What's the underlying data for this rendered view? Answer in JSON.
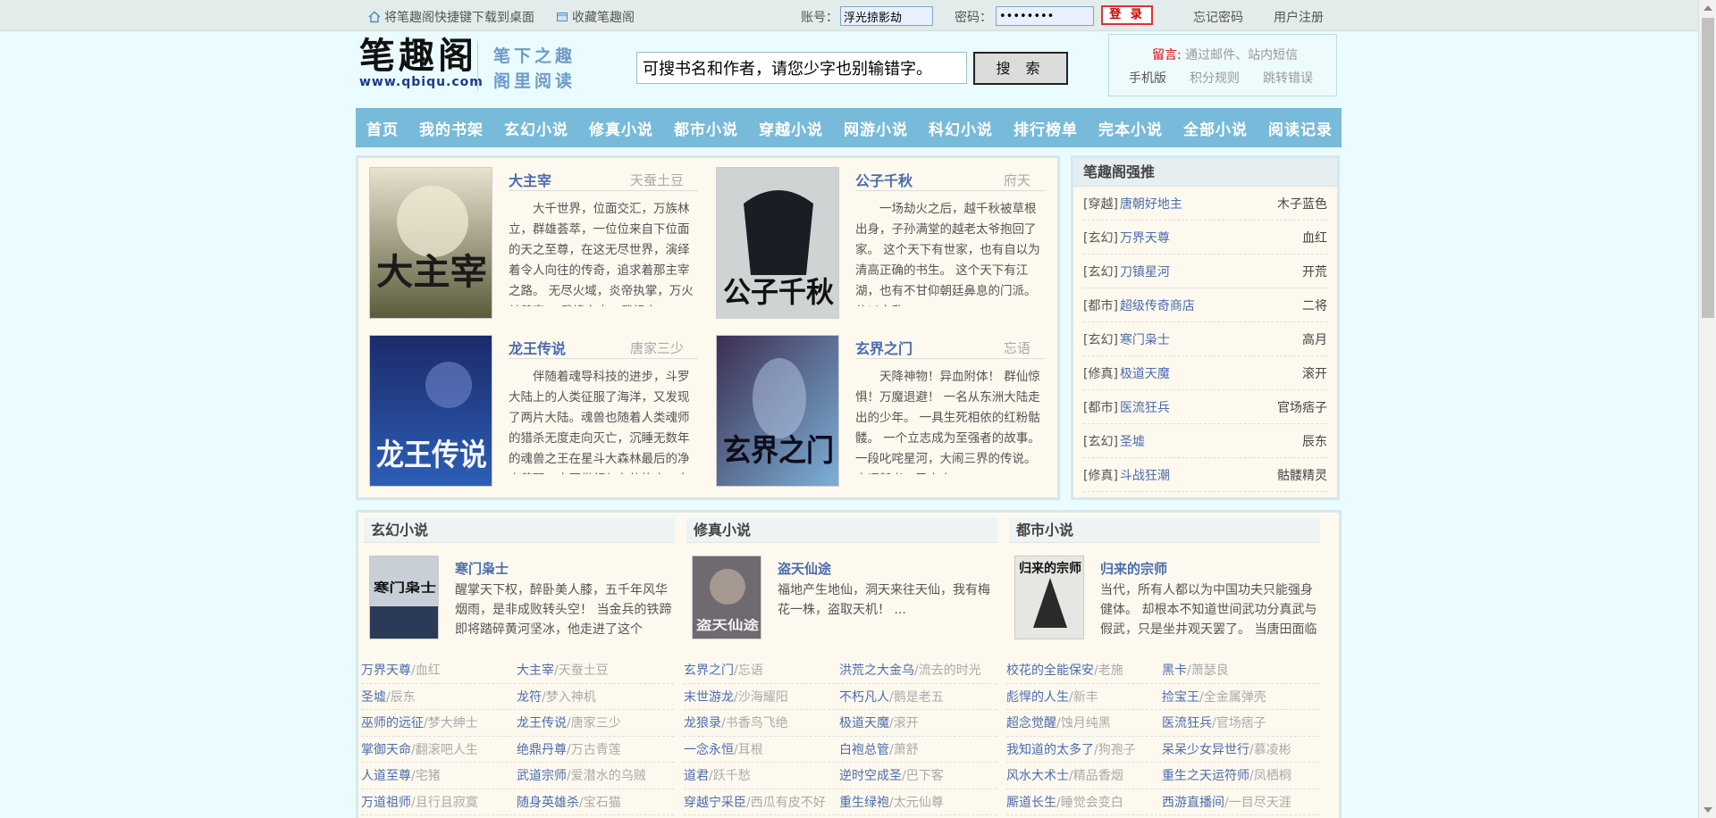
{
  "topbar": {
    "shortcut_label": "将笔趣阁快捷键下载到桌面",
    "favorite_label": "收藏笔趣阁",
    "account_label": "账号：",
    "account_value": "浮光掠影劫",
    "password_label": "密码：",
    "password_value": "••••••••",
    "login_label": "登 录",
    "forgot_label": "忘记密码",
    "register_label": "用户注册"
  },
  "header": {
    "logo_cn": "笔趣阁",
    "logo_url": "www.qbiqu.com",
    "slogan_1": "笔下之趣",
    "slogan_2": "阁里阅读",
    "search_value": "可搜书名和作者，请您少字也别输错字。",
    "search_button": "搜 索",
    "notice_label": "留言:",
    "notice_text": "通过邮件、站内短信",
    "notice_links": [
      "手机版",
      "积分规则",
      "跳转错误"
    ]
  },
  "nav": [
    "首页",
    "我的书架",
    "玄幻小说",
    "修真小说",
    "都市小说",
    "穿越小说",
    "网游小说",
    "科幻小说",
    "排行榜单",
    "完本小说",
    "全部小说",
    "阅读记录"
  ],
  "featured": [
    {
      "title": "大主宰",
      "author": "天蚕土豆",
      "desc": "大千世界，位面交汇，万族林立，群雄荟萃，一位位来自下位面的天之至尊，在这无尽世界，演绎着令人向往的传奇，追求着那主宰之路。 无尽火域，炎帝执掌，万火焚苍穹。 武境之内，武祖之",
      "cover_text": "大主宰"
    },
    {
      "title": "公子千秋",
      "author": "府天",
      "desc": "一场劫火之后，越千秋被草根出身，子孙满堂的越老太爷抱回了家。 这个天下有世家，也有自以为清高正确的书生。 这个天下有江湖，也有不甘仰朝廷鼻息的门派。 偏以文乱",
      "cover_text": "公子千秋"
    },
    {
      "title": "龙王传说",
      "author": "唐家三少",
      "desc": "伴随着魂导科技的进步，斗罗大陆上的人类征服了海洋，又发现了两片大陆。魂兽也随着人类魂师的猎杀无度走向灭亡，沉睡无数年的魂兽之王在星斗大森林最后的净土苏醒，它要带领仅存的族人，向",
      "cover_text": "龙王传说"
    },
    {
      "title": "玄界之门",
      "author": "忘语",
      "desc": "天降神物！异血附体！ 群仙惊惧！万魔退避！ 一名从东洲大陆走出的少年。 一具生死相依的红粉骷髅。 一个立志成为至强者的故事。 一段叱咤星河，大闹三界的传说。 忘语新书，已完本",
      "cover_text": "玄界之门"
    }
  ],
  "recommend": {
    "title": "笔趣阁强推",
    "items": [
      {
        "cat": "[穿越]",
        "book": "唐朝好地主",
        "author": "木子蓝色"
      },
      {
        "cat": "[玄幻]",
        "book": "万界天尊",
        "author": "血红"
      },
      {
        "cat": "[玄幻]",
        "book": "刀镇星河",
        "author": "开荒"
      },
      {
        "cat": "[都市]",
        "book": "超级传奇商店",
        "author": "二将"
      },
      {
        "cat": "[玄幻]",
        "book": "寒门枭士",
        "author": "高月"
      },
      {
        "cat": "[修真]",
        "book": "极道天魔",
        "author": "滚开"
      },
      {
        "cat": "[都市]",
        "book": "医流狂兵",
        "author": "官场痞子"
      },
      {
        "cat": "[玄幻]",
        "book": "圣墟",
        "author": "辰东"
      },
      {
        "cat": "[修真]",
        "book": "斗战狂潮",
        "author": "骷髅精灵"
      }
    ]
  },
  "categories": [
    {
      "title": "玄幻小说",
      "feature_title": "寒门枭士",
      "feature_desc": "醒掌天下权，醉卧美人膝，五千年风华烟雨，是非成败转头空！ 当金兵的铁蹄即将踏碎黄河坚冰，他走进了这个",
      "cover_text": "寒门枭士",
      "books": [
        [
          {
            "name": "万界天尊",
            "author": "/血红"
          },
          {
            "name": "大主宰",
            "author": "/天蚕土豆"
          }
        ],
        [
          {
            "name": "圣墟",
            "author": "/辰东"
          },
          {
            "name": "龙符",
            "author": "/梦入神机"
          }
        ],
        [
          {
            "name": "巫师的远征",
            "author": "/梦大绅士"
          },
          {
            "name": "龙王传说",
            "author": "/唐家三少"
          }
        ],
        [
          {
            "name": "掌御天命",
            "author": "/翻滚吧人生"
          },
          {
            "name": "绝鼎丹尊",
            "author": "/万古青莲"
          }
        ],
        [
          {
            "name": "人道至尊",
            "author": "/宅猪"
          },
          {
            "name": "武道宗师",
            "author": "/爱潜水的乌贼"
          }
        ],
        [
          {
            "name": "万道祖师",
            "author": "/且行且寂寞"
          },
          {
            "name": "随身英雄杀",
            "author": "/宝石猫"
          }
        ]
      ]
    },
    {
      "title": "修真小说",
      "feature_title": "盗天仙途",
      "feature_desc": "福地产生地仙，洞天来往天仙，我有梅花一株，盗取天机！ ...",
      "cover_text": "盗天仙途",
      "books": [
        [
          {
            "name": "玄界之门",
            "author": "/忘语"
          },
          {
            "name": "洪荒之大金乌",
            "author": "/流去的时光"
          }
        ],
        [
          {
            "name": "末世游龙",
            "author": "/沙海耀阳"
          },
          {
            "name": "不朽凡人",
            "author": "/鹅是老五"
          }
        ],
        [
          {
            "name": "龙狼录",
            "author": "/书香鸟飞绝"
          },
          {
            "name": "极道天魔",
            "author": "/滚开"
          }
        ],
        [
          {
            "name": "一念永恒",
            "author": "/耳根"
          },
          {
            "name": "白袍总管",
            "author": "/萧舒"
          }
        ],
        [
          {
            "name": "道君",
            "author": "/跃千愁"
          },
          {
            "name": "逆时空成圣",
            "author": "/巴下客"
          }
        ],
        [
          {
            "name": "穿越宁采臣",
            "author": "/西瓜有皮不好"
          },
          {
            "name": "重生绿袍",
            "author": "/太元仙尊"
          }
        ]
      ]
    },
    {
      "title": "都市小说",
      "feature_title": "归来的宗师",
      "feature_desc": "当代，所有人都以为中国功夫只能强身健体。 却根本不知道世间武功分真武与假武，只是坐井观天罢了。 当唐田面临",
      "cover_text": "归来的宗师",
      "books": [
        [
          {
            "name": "校花的全能保安",
            "author": "/老施"
          },
          {
            "name": "黑卡",
            "author": "/萧瑟良"
          }
        ],
        [
          {
            "name": "彪悍的人生",
            "author": "/新丰"
          },
          {
            "name": "捡宝王",
            "author": "/全金属弹壳"
          }
        ],
        [
          {
            "name": "超念觉醒",
            "author": "/蚀月纯黑"
          },
          {
            "name": "医流狂兵",
            "author": "/官场痞子"
          }
        ],
        [
          {
            "name": "我知道的太多了",
            "author": "/狗孢子"
          },
          {
            "name": "呆呆少女异世行",
            "author": "/慕凌彬"
          }
        ],
        [
          {
            "name": "风水大术士",
            "author": "/精品香烟"
          },
          {
            "name": "重生之天运符师",
            "author": "/凤栖桐"
          }
        ],
        [
          {
            "name": "厮道长生",
            "author": "/睡觉会变白"
          },
          {
            "name": "西游直播间",
            "author": "/一目尽天涯"
          }
        ]
      ]
    }
  ],
  "colors": {
    "background": "#eafcff",
    "nav": "#78bad9",
    "link": "#4b6cb1",
    "panel": "#fdf9ee"
  }
}
